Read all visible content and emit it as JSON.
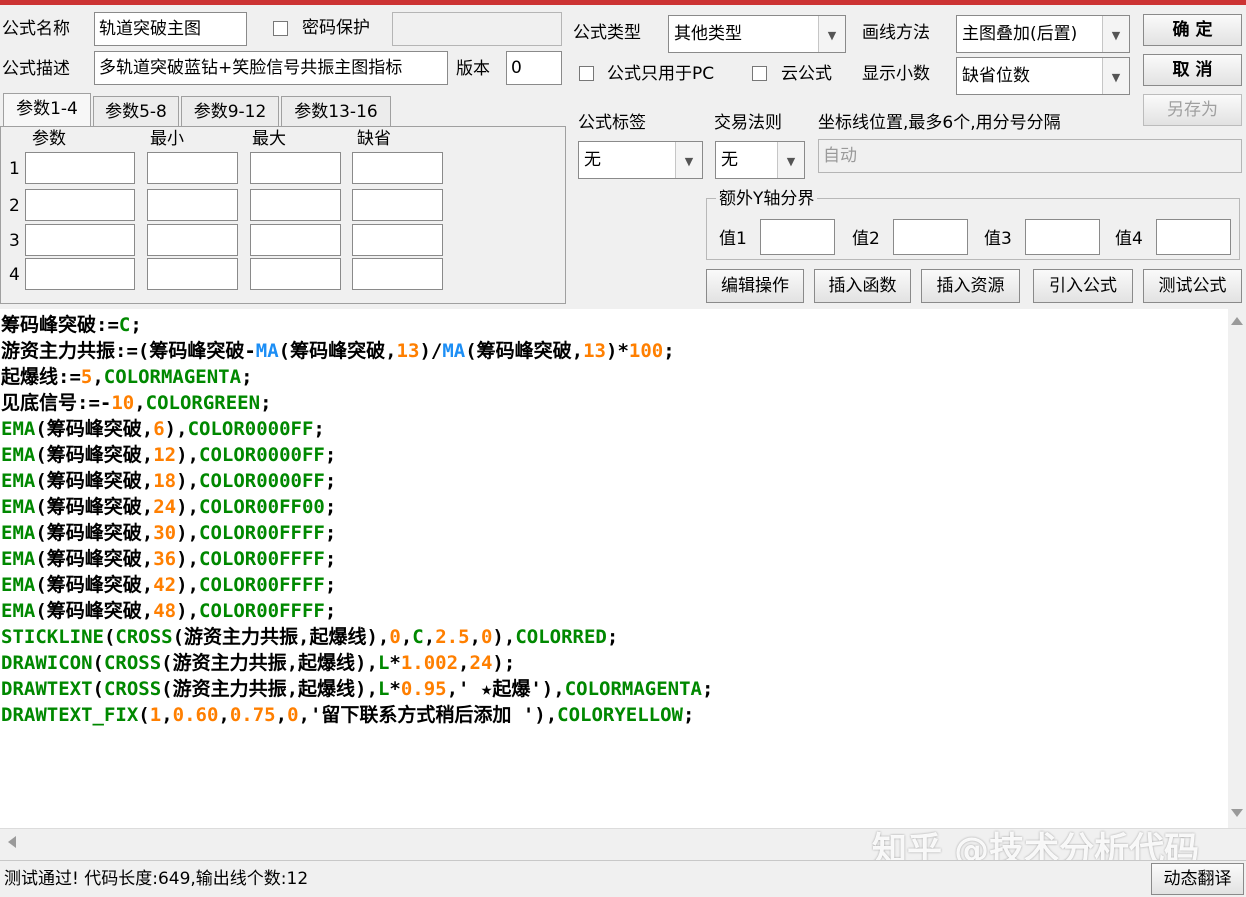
{
  "top": {
    "name_label": "公式名称",
    "name_value": "轨道突破主图",
    "password_label": "密码保护",
    "password_checked": false,
    "password_value": "",
    "type_label": "公式类型",
    "type_value": "其他类型",
    "draw_label": "画线方法",
    "draw_value": "主图叠加(后置)",
    "ok_button": "确 定",
    "desc_label": "公式描述",
    "desc_value": "多轨道突破蓝钻+笑脸信号共振主图指标",
    "version_label": "版本",
    "version_value": "0",
    "pc_only_label": "公式只用于PC",
    "pc_only_checked": false,
    "cloud_label": "云公式",
    "cloud_checked": false,
    "decimals_label": "显示小数",
    "decimals_value": "缺省位数",
    "cancel_button": "取 消",
    "save_as_button": "另存为"
  },
  "params": {
    "tabs": [
      "参数1-4",
      "参数5-8",
      "参数9-12",
      "参数13-16"
    ],
    "active_tab": 0,
    "headers": [
      "参数",
      "最小",
      "最大",
      "缺省"
    ],
    "rows": [
      {
        "num": "1",
        "name": "",
        "min": "",
        "max": "",
        "default": ""
      },
      {
        "num": "2",
        "name": "",
        "min": "",
        "max": "",
        "default": ""
      },
      {
        "num": "3",
        "name": "",
        "min": "",
        "max": "",
        "default": ""
      },
      {
        "num": "4",
        "name": "",
        "min": "",
        "max": "",
        "default": ""
      }
    ]
  },
  "right": {
    "tag_label": "公式标签",
    "tag_value": "无",
    "rule_label": "交易法则",
    "rule_value": "无",
    "coord_label": "坐标线位置,最多6个,用分号分隔",
    "coord_value": "自动",
    "extra_y_label": "额外Y轴分界",
    "values": [
      {
        "label": "值1",
        "value": ""
      },
      {
        "label": "值2",
        "value": ""
      },
      {
        "label": "值3",
        "value": ""
      },
      {
        "label": "值4",
        "value": ""
      }
    ],
    "buttons": [
      "编辑操作",
      "插入函数",
      "插入资源",
      "引入公式",
      "测试公式"
    ]
  },
  "code_lines": [
    [
      [
        "筹码峰突破:=",
        "b"
      ],
      [
        "C",
        "g"
      ],
      [
        ";",
        "b"
      ]
    ],
    [
      [
        "游资主力共振:=(筹码峰突破-",
        "b"
      ],
      [
        "MA",
        "bl"
      ],
      [
        "(筹码峰突破,",
        "b"
      ],
      [
        "13",
        "o"
      ],
      [
        ")/",
        "b"
      ],
      [
        "MA",
        "bl"
      ],
      [
        "(筹码峰突破,",
        "b"
      ],
      [
        "13",
        "o"
      ],
      [
        ")*",
        "b"
      ],
      [
        "100",
        "o"
      ],
      [
        ";",
        "b"
      ]
    ],
    [
      [
        "起爆线:=",
        "b"
      ],
      [
        "5",
        "o"
      ],
      [
        ",",
        "b"
      ],
      [
        "COLORMAGENTA",
        "g"
      ],
      [
        ";",
        "b"
      ]
    ],
    [
      [
        "见底信号:=-",
        "b"
      ],
      [
        "10",
        "o"
      ],
      [
        ",",
        "b"
      ],
      [
        "COLORGREEN",
        "g"
      ],
      [
        ";",
        "b"
      ]
    ],
    [
      [
        "EMA",
        "g"
      ],
      [
        "(筹码峰突破,",
        "b"
      ],
      [
        "6",
        "o"
      ],
      [
        "),",
        "b"
      ],
      [
        "COLOR0000FF",
        "g"
      ],
      [
        ";",
        "b"
      ]
    ],
    [
      [
        "EMA",
        "g"
      ],
      [
        "(筹码峰突破,",
        "b"
      ],
      [
        "12",
        "o"
      ],
      [
        "),",
        "b"
      ],
      [
        "COLOR0000FF",
        "g"
      ],
      [
        ";",
        "b"
      ]
    ],
    [
      [
        "EMA",
        "g"
      ],
      [
        "(筹码峰突破,",
        "b"
      ],
      [
        "18",
        "o"
      ],
      [
        "),",
        "b"
      ],
      [
        "COLOR0000FF",
        "g"
      ],
      [
        ";",
        "b"
      ]
    ],
    [
      [
        "EMA",
        "g"
      ],
      [
        "(筹码峰突破,",
        "b"
      ],
      [
        "24",
        "o"
      ],
      [
        "),",
        "b"
      ],
      [
        "COLOR00FF00",
        "g"
      ],
      [
        ";",
        "b"
      ]
    ],
    [
      [
        "EMA",
        "g"
      ],
      [
        "(筹码峰突破,",
        "b"
      ],
      [
        "30",
        "o"
      ],
      [
        "),",
        "b"
      ],
      [
        "COLOR00FFFF",
        "g"
      ],
      [
        ";",
        "b"
      ]
    ],
    [
      [
        "EMA",
        "g"
      ],
      [
        "(筹码峰突破,",
        "b"
      ],
      [
        "36",
        "o"
      ],
      [
        "),",
        "b"
      ],
      [
        "COLOR00FFFF",
        "g"
      ],
      [
        ";",
        "b"
      ]
    ],
    [
      [
        "EMA",
        "g"
      ],
      [
        "(筹码峰突破,",
        "b"
      ],
      [
        "42",
        "o"
      ],
      [
        "),",
        "b"
      ],
      [
        "COLOR00FFFF",
        "g"
      ],
      [
        ";",
        "b"
      ]
    ],
    [
      [
        "EMA",
        "g"
      ],
      [
        "(筹码峰突破,",
        "b"
      ],
      [
        "48",
        "o"
      ],
      [
        "),",
        "b"
      ],
      [
        "COLOR00FFFF",
        "g"
      ],
      [
        ";",
        "b"
      ]
    ],
    [
      [
        "STICKLINE",
        "g"
      ],
      [
        "(",
        "b"
      ],
      [
        "CROSS",
        "g"
      ],
      [
        "(游资主力共振,起爆线),",
        "b"
      ],
      [
        "0",
        "o"
      ],
      [
        ",",
        "b"
      ],
      [
        "C",
        "g"
      ],
      [
        ",",
        "b"
      ],
      [
        "2.5",
        "o"
      ],
      [
        ",",
        "b"
      ],
      [
        "0",
        "o"
      ],
      [
        "),",
        "b"
      ],
      [
        "COLORRED",
        "g"
      ],
      [
        ";",
        "b"
      ]
    ],
    [
      [
        "DRAWICON",
        "g"
      ],
      [
        "(",
        "b"
      ],
      [
        "CROSS",
        "g"
      ],
      [
        "(游资主力共振,起爆线),",
        "b"
      ],
      [
        "L",
        "g"
      ],
      [
        "*",
        "b"
      ],
      [
        "1.002",
        "o"
      ],
      [
        ",",
        "b"
      ],
      [
        "24",
        "o"
      ],
      [
        ");",
        "b"
      ]
    ],
    [
      [
        "DRAWTEXT",
        "g"
      ],
      [
        "(",
        "b"
      ],
      [
        "CROSS",
        "g"
      ],
      [
        "(游资主力共振,起爆线),",
        "b"
      ],
      [
        "L",
        "g"
      ],
      [
        "*",
        "b"
      ],
      [
        "0.95",
        "o"
      ],
      [
        ",' ★起爆'),",
        "b"
      ],
      [
        "COLORMAGENTA",
        "g"
      ],
      [
        ";",
        "b"
      ]
    ],
    [
      [
        "DRAWTEXT_FIX",
        "g"
      ],
      [
        "(",
        "b"
      ],
      [
        "1",
        "o"
      ],
      [
        ",",
        "b"
      ],
      [
        "0.60",
        "o"
      ],
      [
        ",",
        "b"
      ],
      [
        "0.75",
        "o"
      ],
      [
        ",",
        "b"
      ],
      [
        "0",
        "o"
      ],
      [
        ",'留下联系方式稍后添加 '),",
        "b"
      ],
      [
        "COLORYELLOW",
        "g"
      ],
      [
        ";",
        "b"
      ]
    ]
  ],
  "status": {
    "message": "测试通过! 代码长度:649,输出线个数:12",
    "translate_button": "动态翻译"
  },
  "watermark": "知乎 @技术分析代码",
  "colors": {
    "code_green": "#008800",
    "code_orange": "#ff7f00",
    "code_blue": "#1c8ef5",
    "title_bar": "#cc3333"
  }
}
